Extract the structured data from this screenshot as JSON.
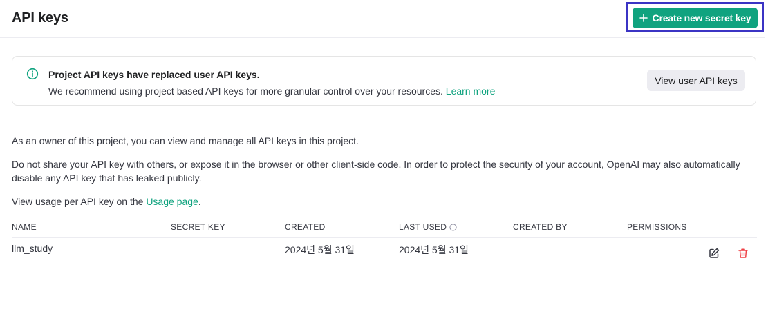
{
  "header": {
    "title": "API keys",
    "create_button_label": "Create new secret key"
  },
  "notice": {
    "title": "Project API keys have replaced user API keys.",
    "text": "We recommend using project based API keys for more granular control over your resources.",
    "link": "Learn more",
    "button_label": "View user API keys"
  },
  "body": {
    "p1": "As an owner of this project, you can view and manage all API keys in this project.",
    "p2": "Do not share your API key with others, or expose it in the browser or other client-side code. In order to protect the security of your account, OpenAI may also automatically disable any API key that has leaked publicly.",
    "p3_prefix": "View usage per API key on the",
    "p3_link": "Usage page",
    "p3_suffix": "."
  },
  "table": {
    "columns": [
      "NAME",
      "SECRET KEY",
      "CREATED",
      "LAST USED",
      "CREATED BY",
      "PERMISSIONS"
    ],
    "rows": [
      {
        "name": "llm_study",
        "secret_key": "",
        "created": "2024년 5월 31일",
        "last_used": "2024년 5월 31일",
        "created_by": "",
        "permissions": ""
      }
    ]
  },
  "colors": {
    "accent": "#10a37f",
    "focus_outline": "#3b34c4",
    "delete": "#ef4146"
  },
  "icons": {
    "create": "plus-icon",
    "notice": "info-icon",
    "last_used_hint": "info-icon",
    "edit": "edit-icon",
    "delete": "trash-icon"
  }
}
